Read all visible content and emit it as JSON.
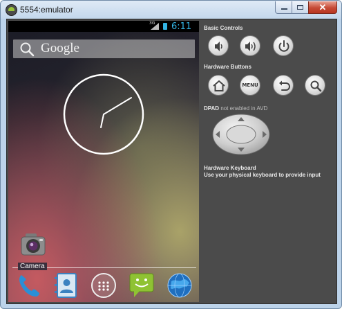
{
  "window": {
    "title": "5554:emulator",
    "close_glyph": "✕"
  },
  "device": {
    "status": {
      "network": "3G",
      "time": "6:11"
    },
    "search": {
      "label": "Google",
      "icon": "search-icon"
    },
    "clock": {
      "icon": "analog-clock-icon"
    },
    "home_app": {
      "label": "Camera",
      "icon": "camera-icon"
    },
    "dock": [
      {
        "name": "phone",
        "icon": "phone-icon"
      },
      {
        "name": "contacts",
        "icon": "contacts-icon"
      },
      {
        "name": "all-apps",
        "icon": "apps-grid-icon"
      },
      {
        "name": "messaging",
        "icon": "messaging-icon"
      },
      {
        "name": "browser",
        "icon": "globe-icon"
      }
    ]
  },
  "controls": {
    "basic_controls_label": "Basic Controls",
    "hardware_buttons_label": "Hardware Buttons",
    "menu_label": "MENU",
    "dpad_label": "DPAD",
    "dpad_note": "not enabled in AVD",
    "keyboard_label": "Hardware Keyboard",
    "keyboard_hint": "Use your physical keyboard to provide input"
  },
  "colors": {
    "accent": "#33b5e5",
    "panel_bg": "#4b4b4b",
    "title_bar": "#c3d7ec",
    "close_button": "#c64a35"
  }
}
